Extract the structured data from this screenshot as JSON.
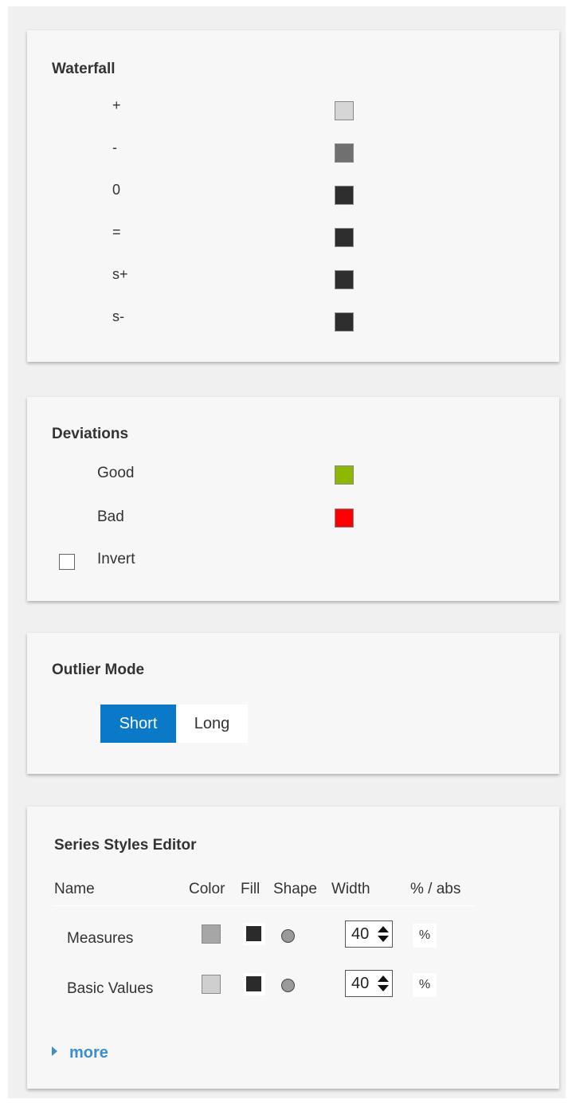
{
  "waterfall": {
    "title": "Waterfall",
    "rows": [
      {
        "label": "+",
        "color": "#d6d6d6"
      },
      {
        "label": "-",
        "color": "#707070"
      },
      {
        "label": "0",
        "color": "#2e2e2e"
      },
      {
        "label": "=",
        "color": "#2e2e2e"
      },
      {
        "label": "s+",
        "color": "#2e2e2e"
      },
      {
        "label": "s-",
        "color": "#2e2e2e"
      }
    ]
  },
  "deviations": {
    "title": "Deviations",
    "good": {
      "label": "Good",
      "color": "#8cb800"
    },
    "bad": {
      "label": "Bad",
      "color": "#ff0000"
    },
    "invert": {
      "label": "Invert",
      "checked": false
    }
  },
  "outlier": {
    "title": "Outlier Mode",
    "options": [
      "Short",
      "Long"
    ],
    "selected": "Short"
  },
  "series": {
    "title": "Series Styles Editor",
    "headers": {
      "name": "Name",
      "color": "Color",
      "fill": "Fill",
      "shape": "Shape",
      "width": "Width",
      "unit": "% / abs"
    },
    "rows": [
      {
        "name": "Measures",
        "color": "#a6a6a6",
        "fill": "#2b2b2b",
        "shape": "circle",
        "width": "40",
        "unit": "%"
      },
      {
        "name": "Basic Values",
        "color": "#cfcfcf",
        "fill": "#2b2b2b",
        "shape": "circle",
        "width": "40",
        "unit": "%"
      }
    ],
    "more_label": "more"
  }
}
